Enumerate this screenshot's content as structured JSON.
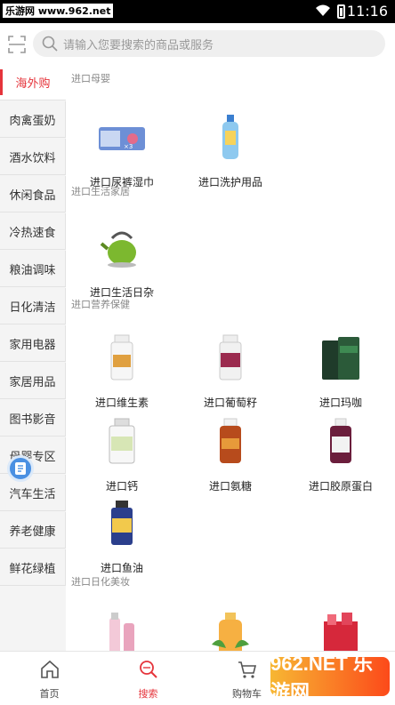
{
  "status": {
    "watermark": "乐游网 www.962.net",
    "time": "11:16"
  },
  "search": {
    "placeholder": "请输入您要搜索的商品或服务"
  },
  "sidebar": {
    "items": [
      {
        "label": "海外购"
      },
      {
        "label": "肉禽蛋奶"
      },
      {
        "label": "酒水饮料"
      },
      {
        "label": "休闲食品"
      },
      {
        "label": "冷热速食"
      },
      {
        "label": "粮油调味"
      },
      {
        "label": "日化清洁"
      },
      {
        "label": "家用电器"
      },
      {
        "label": "家居用品"
      },
      {
        "label": "图书影音"
      },
      {
        "label": "母婴专区"
      },
      {
        "label": "汽车生活"
      },
      {
        "label": "养老健康"
      },
      {
        "label": "鲜花绿植"
      }
    ]
  },
  "sections": [
    {
      "title": "进口母婴",
      "products": [
        {
          "label": "进口尿裤湿巾"
        },
        {
          "label": "进口洗护用品"
        }
      ]
    },
    {
      "title": "进口生活家居",
      "products": [
        {
          "label": "进口生活日杂"
        }
      ]
    },
    {
      "title": "进口营养保健",
      "products": [
        {
          "label": "进口维生素"
        },
        {
          "label": "进口葡萄籽"
        },
        {
          "label": "进口玛咖"
        },
        {
          "label": "进口钙"
        },
        {
          "label": "进口氨糖"
        },
        {
          "label": "进口胶原蛋白"
        },
        {
          "label": "进口鱼油"
        }
      ]
    },
    {
      "title": "进口日化美妆",
      "products": [
        {
          "label": ""
        },
        {
          "label": ""
        },
        {
          "label": ""
        }
      ]
    }
  ],
  "tabbar": {
    "items": [
      {
        "label": "首页"
      },
      {
        "label": "搜索"
      },
      {
        "label": "购物车"
      },
      {
        "label": ""
      }
    ]
  },
  "watermark2": "962.NET 乐游网",
  "colors": {
    "accent": "#e5343b"
  }
}
